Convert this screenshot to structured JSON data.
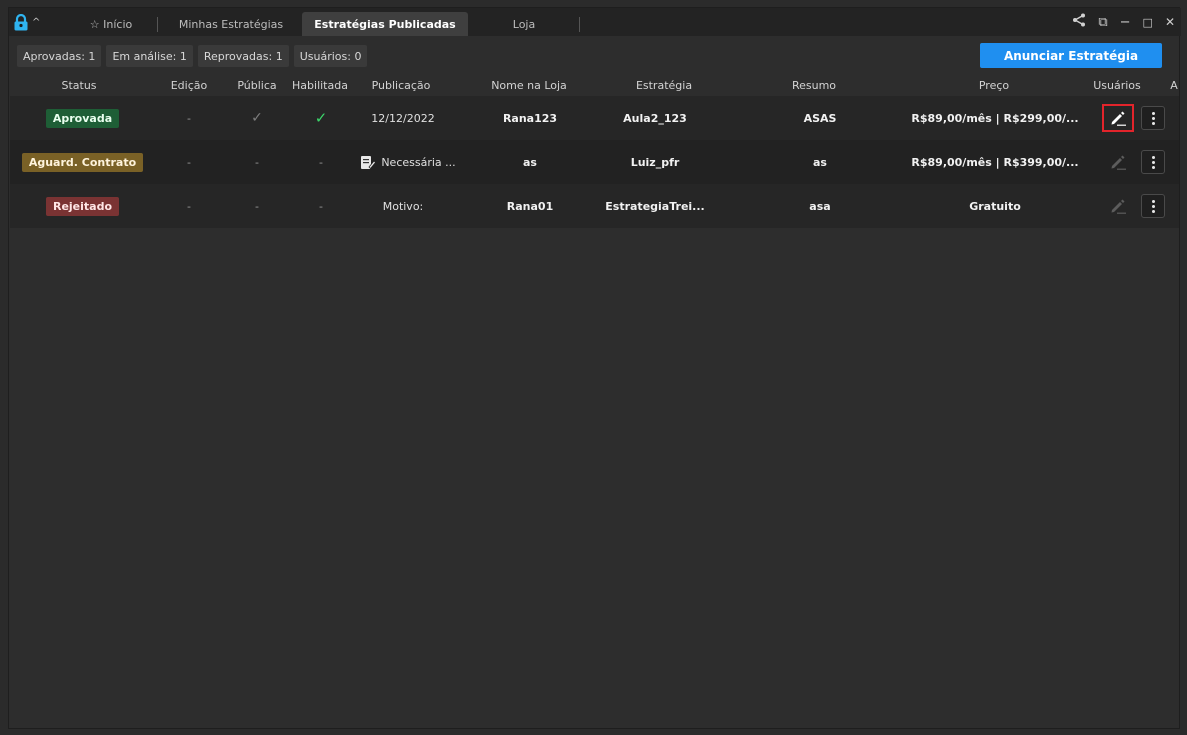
{
  "tabs": [
    {
      "label": "☆ Início"
    },
    {
      "label": "Minhas Estratégias"
    },
    {
      "label": "Estratégias Publicadas"
    },
    {
      "label": "Loja"
    }
  ],
  "window_controls": {
    "share": "<",
    "restore": "⧉",
    "minimize": "−",
    "maximize": "□",
    "close": "✕"
  },
  "filters": [
    {
      "label": "Aprovadas: 1"
    },
    {
      "label": "Em análise: 1"
    },
    {
      "label": "Reprovadas: 1"
    },
    {
      "label": "Usuários: 0"
    }
  ],
  "announce_button": "Anunciar Estratégia",
  "columns": [
    "Status",
    "Edição",
    "Pública",
    "Habilitada",
    "Publicação",
    "Nome na Loja",
    "Estratégia",
    "Resumo",
    "Preço",
    "Usuários",
    "A"
  ],
  "rows": [
    {
      "status": "Aprovada",
      "status_color": "#1e5e36",
      "edicao": "-",
      "publica": "✓",
      "habilitada": "✓",
      "publicacao": "12/12/2022",
      "nome_loja": "Rana123",
      "estrategia": "Aula2_123",
      "resumo": "ASAS",
      "preco": "R$89,00/mês | R$299,00/...",
      "edit_enabled": true,
      "highlighted": true
    },
    {
      "status": "Aguard. Contrato",
      "status_color": "#7a6126",
      "edicao": "-",
      "publica": "-",
      "habilitada": "-",
      "publicacao": "Necessária ...",
      "nome_loja": "as",
      "estrategia": "Luiz_pfr",
      "resumo": "as",
      "preco": "R$89,00/mês | R$399,00/...",
      "edit_enabled": false,
      "highlighted": false
    },
    {
      "status": "Rejeitado",
      "status_color": "#7a3333",
      "edicao": "-",
      "publica": "-",
      "habilitada": "-",
      "publicacao": "Motivo:",
      "nome_loja": "Rana01",
      "estrategia": "EstrategiaTrei...",
      "resumo": "asa",
      "preco": "Gratuito",
      "edit_enabled": false,
      "highlighted": false
    }
  ],
  "colors": {
    "accent": "#1f8ff0",
    "highlight": "#e3242b",
    "background": "#2d2d2d"
  }
}
